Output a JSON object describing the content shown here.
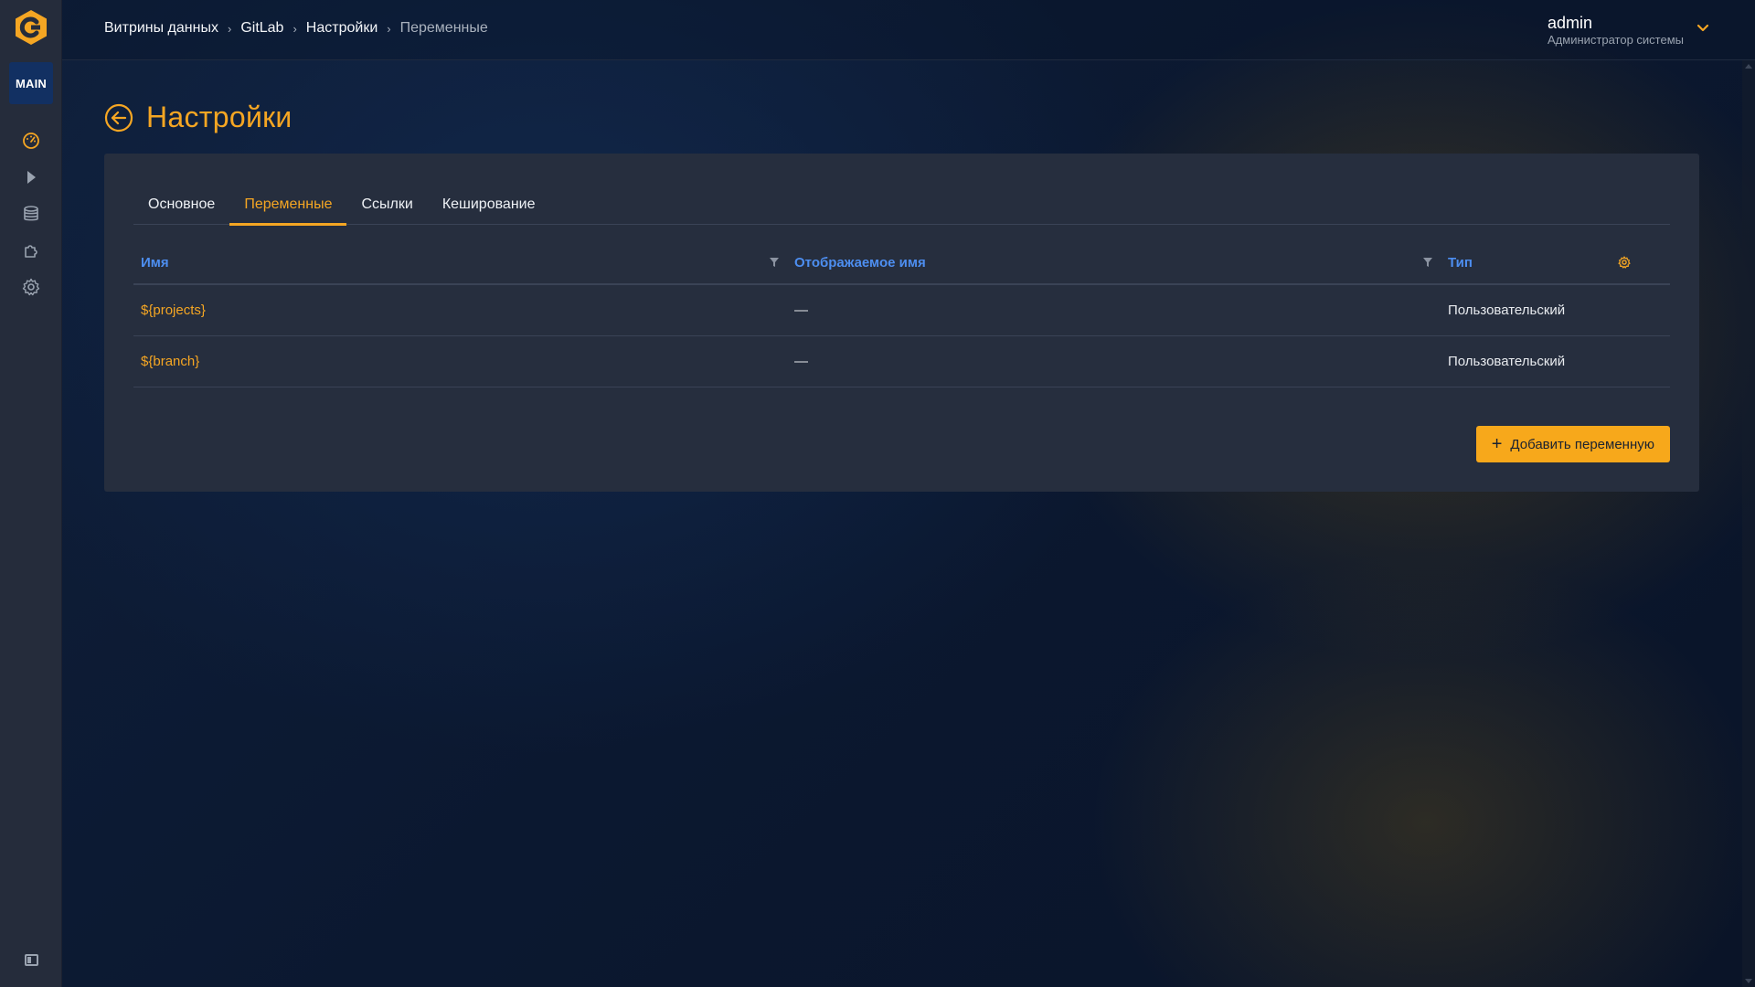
{
  "sidebar": {
    "logo_icon": "app-logo",
    "workspace": "MAIN",
    "items": [
      {
        "icon": "dashboard-icon"
      },
      {
        "icon": "play-icon"
      },
      {
        "icon": "database-icon"
      },
      {
        "icon": "puzzle-icon"
      },
      {
        "icon": "gear-icon"
      }
    ],
    "collapse_icon": "sidebar-collapse-icon"
  },
  "breadcrumb": [
    "Витрины данных",
    "GitLab",
    "Настройки",
    "Переменные"
  ],
  "user": {
    "name": "admin",
    "role": "Администратор системы"
  },
  "page": {
    "title": "Настройки"
  },
  "tabs": [
    {
      "label": "Основное",
      "active": false
    },
    {
      "label": "Переменные",
      "active": true
    },
    {
      "label": "Ссылки",
      "active": false
    },
    {
      "label": "Кеширование",
      "active": false
    }
  ],
  "table": {
    "columns": {
      "name": "Имя",
      "display_name": "Отображаемое имя",
      "type": "Тип"
    },
    "rows": [
      {
        "name": "${projects}",
        "display_name": "—",
        "type": "Пользовательский"
      },
      {
        "name": "${branch}",
        "display_name": "—",
        "type": "Пользовательский"
      }
    ]
  },
  "actions": {
    "add_variable": "Добавить переменную"
  },
  "colors": {
    "accent": "#f5a623",
    "link_blue": "#4d8ef0",
    "sidebar_bg": "#252c3b",
    "card_bg": "#262e3e"
  }
}
